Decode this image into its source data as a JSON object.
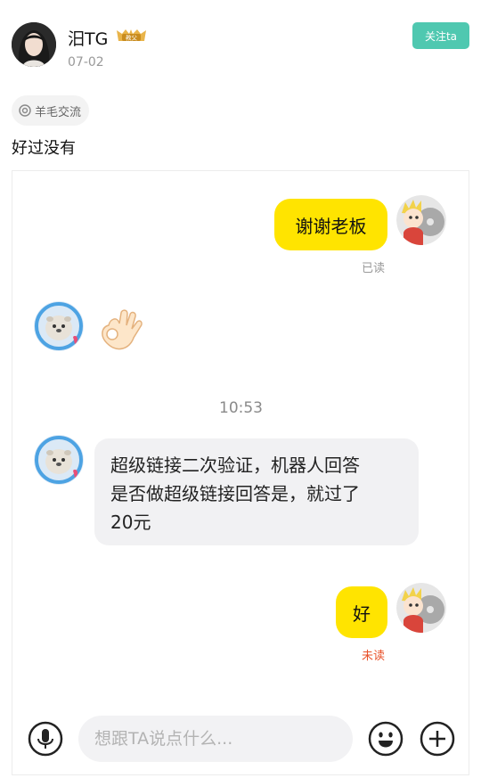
{
  "post": {
    "username": "汨TG",
    "badge": "教父",
    "date": "07-02",
    "follow_label": "关注ta",
    "tag": "羊毛交流",
    "text": "好过没有"
  },
  "chat": {
    "messages": [
      {
        "side": "right",
        "text": "谢谢老板",
        "status": "已读"
      },
      {
        "side": "left",
        "type": "emoji",
        "icon": "ok-hand-emoji"
      },
      {
        "type": "time",
        "text": "10:53"
      },
      {
        "side": "left",
        "lines": [
          "超级链接二次验证，机器人回答",
          "是否做超级链接回答是，就过了",
          "20元"
        ]
      },
      {
        "side": "right",
        "text": "好",
        "status": "未读"
      }
    ],
    "read_color": "#999999",
    "unread_color": "#e8512a",
    "bubble_color": "#ffe400",
    "input_placeholder": "想跟TA说点什么..."
  },
  "colors": {
    "follow_button": "#4fc8b0"
  }
}
